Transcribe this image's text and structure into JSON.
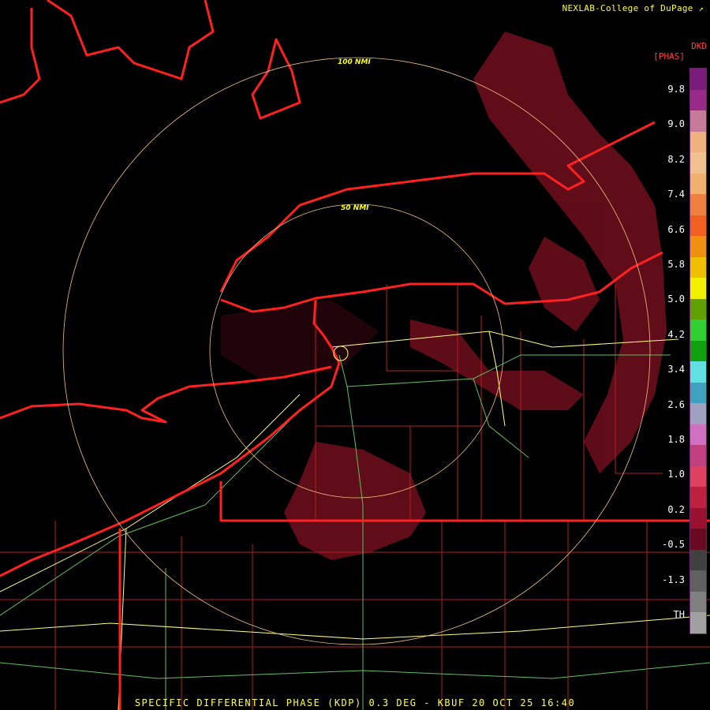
{
  "header": {
    "credit": "NEXLAB-College of DuPage"
  },
  "legend": {
    "product_code": "DKD",
    "unit": "[PHAS]",
    "labels": [
      "9.8",
      "9.0",
      "8.2",
      "7.4",
      "6.6",
      "5.8",
      "5.0",
      "4.2",
      "3.4",
      "2.6",
      "1.8",
      "1.0",
      "0.2",
      "-0.5",
      "-1.3",
      "TH"
    ],
    "colors": [
      "#7a1a7a",
      "#9a2a8a",
      "#c87a9a",
      "#f0b080",
      "#f0c090",
      "#f0b070",
      "#f08040",
      "#f06020",
      "#f09010",
      "#f0c000",
      "#f0f000",
      "#60a000",
      "#30d030",
      "#10a010",
      "#60e0e0",
      "#40a0c0",
      "#a0a0c0",
      "#d070c0",
      "#c04080",
      "#e04060",
      "#c02040",
      "#9a1030",
      "#6a0a20",
      "#404040",
      "#606060",
      "#808080",
      "#a0a0a0"
    ]
  },
  "rings": {
    "outer_label": "100 NMI",
    "inner_label": "50 NMI",
    "color": "#f0c080"
  },
  "caption": "SPECIFIC DIFFERENTIAL PHASE (KDP) 0.3 DEG - KBUF 20 OCT 25 16:40",
  "colors": {
    "coast": "#ff2020",
    "highway": "#ffff80",
    "interstate": "#60c060",
    "county": "#b02020",
    "echo": "#7a1020"
  }
}
